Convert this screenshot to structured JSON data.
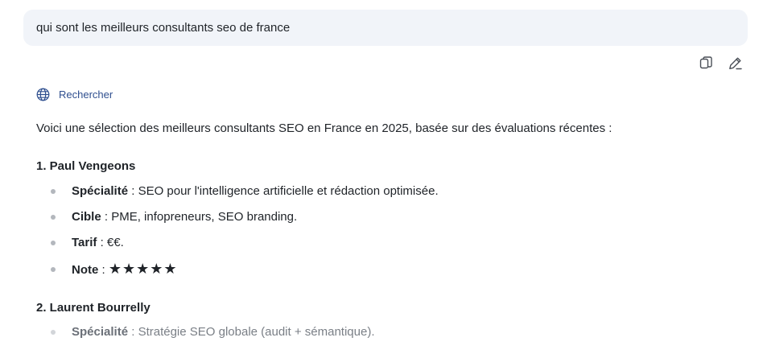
{
  "user_message": "qui sont les meilleurs consultants seo de france",
  "actions": {
    "copy_icon": "copy-icon",
    "edit_icon": "pencil-icon"
  },
  "search": {
    "label": "Rechercher",
    "icon": "globe-icon"
  },
  "answer": {
    "intro": "Voici une sélection des meilleurs consultants SEO en France en 2025, basée sur des évaluations récentes :",
    "consultants": [
      {
        "title": "1. Paul Vengeons",
        "items": [
          {
            "key": "Spécialité",
            "sep": " : ",
            "value": "SEO pour l'intelligence artificielle et rédaction optimisée."
          },
          {
            "key": "Cible",
            "sep": " : ",
            "value": "PME, infopreneurs, SEO branding."
          },
          {
            "key": "Tarif",
            "sep": " : ",
            "value": "€€."
          },
          {
            "key": "Note",
            "sep": " : ",
            "value": "★★★★★"
          }
        ]
      },
      {
        "title": "2. Laurent Bourrelly",
        "items": [
          {
            "key": "Spécialité",
            "sep": " : ",
            "value": "Stratégie SEO globale (audit + sémantique)."
          }
        ]
      }
    ]
  }
}
